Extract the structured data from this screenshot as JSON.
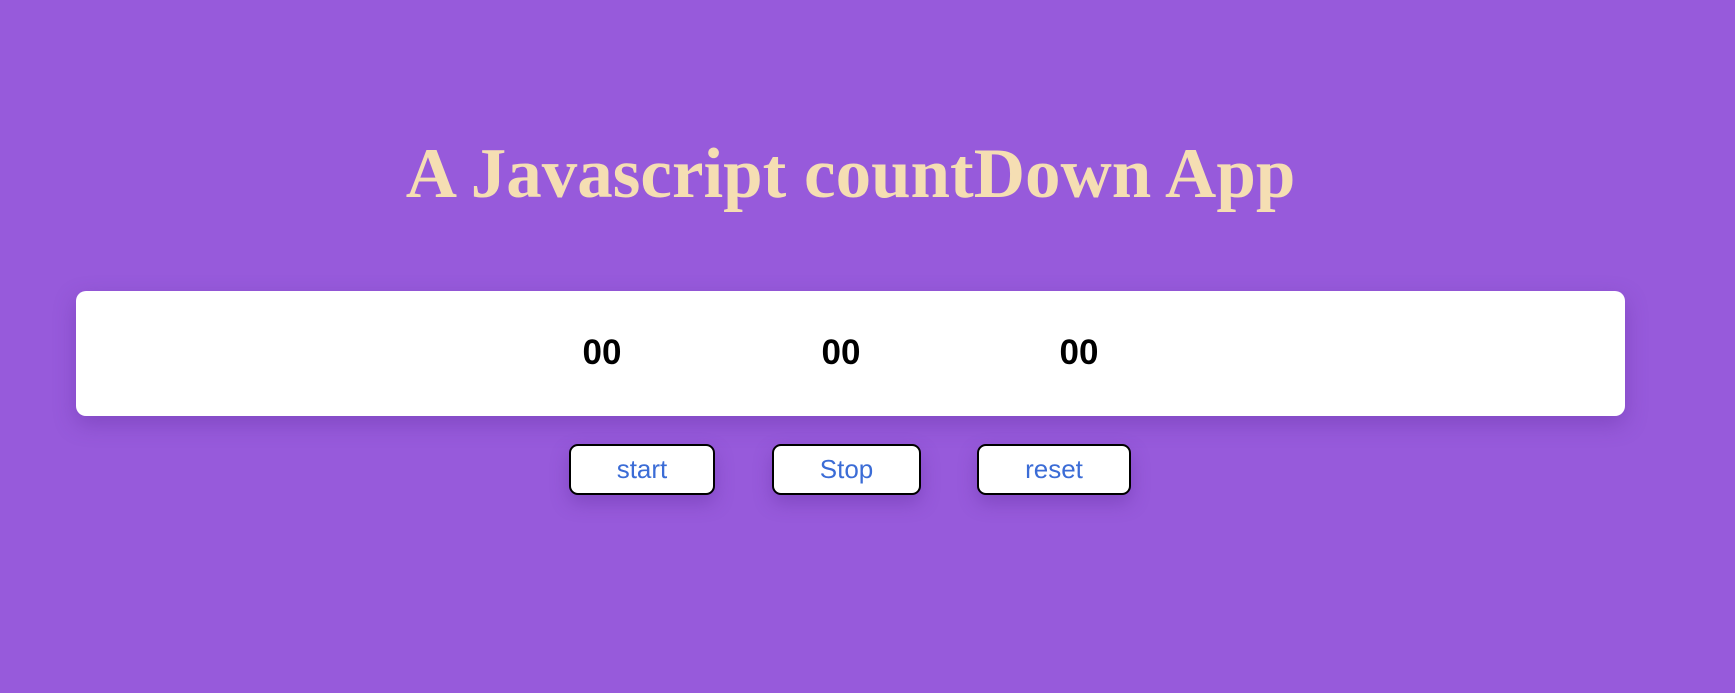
{
  "page": {
    "title": "A Javascript countDown App"
  },
  "timer": {
    "hours": "00",
    "minutes": "00",
    "seconds": "00"
  },
  "controls": {
    "start_label": "start",
    "stop_label": "Stop",
    "reset_label": "reset"
  },
  "colors": {
    "background": "#975ADB",
    "title": "#F5DEB3",
    "panel": "#FFFFFF",
    "digits": "#000000",
    "button_text": "#3B6CD6",
    "button_border": "#000000"
  }
}
